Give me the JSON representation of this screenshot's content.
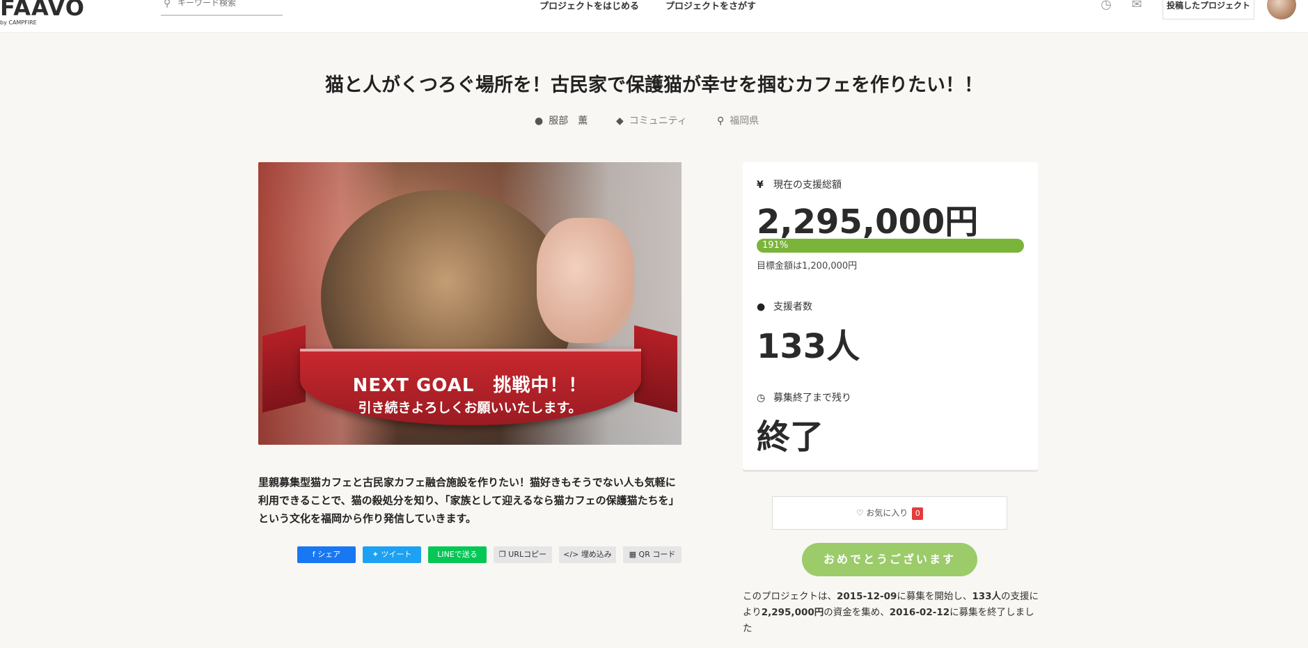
{
  "header": {
    "logo_text": "FAAVO",
    "logo_sub": "by CAMPFIRE",
    "search_placeholder": "キーワード検索",
    "nav_start": "プロジェクトをはじめる",
    "nav_find": "プロジェクトをさがす",
    "posted_projects": "投稿したプロジェクト",
    "icons": [
      "history-icon",
      "mail-icon"
    ]
  },
  "project": {
    "title": "猫と人がくつろぐ場所を！古民家で保護猫が幸せを掴むカフェを作りたい！！",
    "owner": "服部　薫",
    "category": "コミュニティ",
    "location": "福岡県",
    "hero_ribbon_line1": "NEXT GOAL　挑戦中！！",
    "hero_ribbon_line2": "引き続きよろしくお願いいたします。",
    "description": "里親募集型猫カフェと古民家カフェ融合施設を作りたい！猫好きもそうでない人も気軽に利用できることで、猫の殺処分を知り、「家族として迎えるなら猫カフェの保護猫たちを」という文化を福岡から作り発信していきます。"
  },
  "share": {
    "facebook": "シェア",
    "twitter": "ツイート",
    "line": "LINEで送る",
    "url_copy": "URLコピー",
    "embed": "埋め込み",
    "qr": "QR コード"
  },
  "stats": {
    "amount_label": "現在の支援総額",
    "amount_value": "2,295,000円",
    "progress_percent": "191%",
    "progress_fraction": 1.91,
    "goal_text": "目標金額は1,200,000円",
    "backers_label": "支援者数",
    "backers_value": "133人",
    "remain_label": "募集終了まで残り",
    "remain_value": "終了"
  },
  "actions": {
    "favorite_label": "お気に入り",
    "favorite_count": "0",
    "cta_label": "おめでとうございます"
  },
  "summary": {
    "prefix": "このプロジェクトは、",
    "start_date": "2015-12-09",
    "mid1": "に募集を開始し、",
    "backers": "133人",
    "mid2": "の支援により",
    "amount": "2,295,000円",
    "mid3": "の資金を集め、",
    "end_date": "2016-02-12",
    "suffix": "に募集を終了しました"
  },
  "colors": {
    "accent_green": "#7bb43a",
    "cta_green": "#9ccb6a",
    "badge_red": "#e53b3b",
    "facebook": "#1877f2",
    "twitter": "#1da1f2",
    "line": "#06c755"
  }
}
